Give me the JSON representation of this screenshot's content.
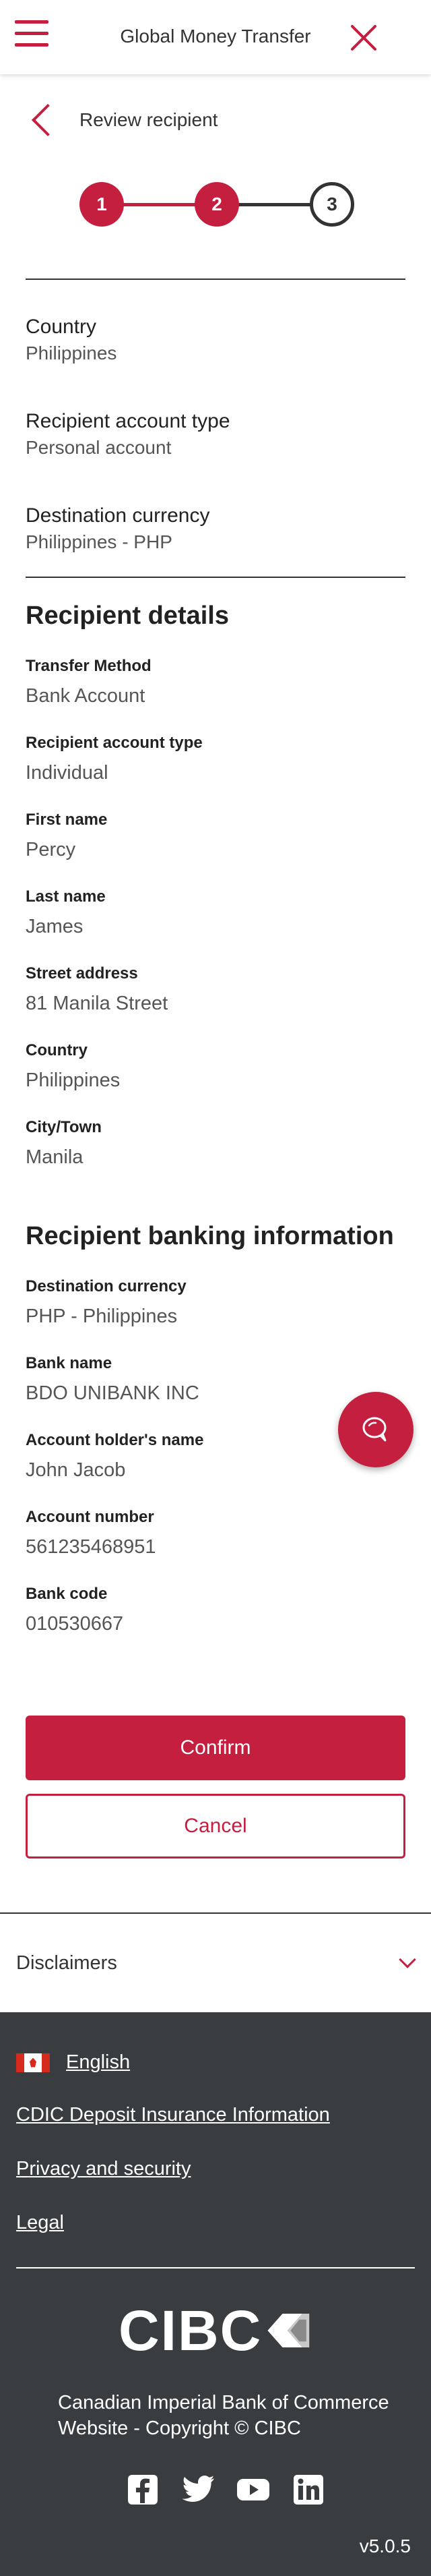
{
  "header": {
    "title": "Global Money Transfer"
  },
  "back": {
    "label": "Review recipient"
  },
  "stepper": {
    "steps": [
      "1",
      "2",
      "3"
    ],
    "current": 3
  },
  "summary": [
    {
      "label": "Country",
      "value": "Philippines"
    },
    {
      "label": "Recipient account type",
      "value": "Personal account"
    },
    {
      "label": "Destination currency",
      "value": "Philippines - PHP"
    }
  ],
  "recipient_details": {
    "title": "Recipient details",
    "fields": [
      {
        "label": "Transfer Method",
        "value": "Bank Account"
      },
      {
        "label": "Recipient account type",
        "value": "Individual"
      },
      {
        "label": "First name",
        "value": "Percy"
      },
      {
        "label": "Last name",
        "value": "James"
      },
      {
        "label": "Street address",
        "value": "81 Manila Street"
      },
      {
        "label": "Country",
        "value": "Philippines"
      },
      {
        "label": "City/Town",
        "value": "Manila"
      }
    ]
  },
  "banking": {
    "title": "Recipient banking information",
    "fields": [
      {
        "label": "Destination currency",
        "value": "PHP - Philippines"
      },
      {
        "label": "Bank name",
        "value": "BDO UNIBANK INC"
      },
      {
        "label": "Account holder's name",
        "value": "John Jacob"
      },
      {
        "label": "Account number",
        "value": "561235468951"
      },
      {
        "label": "Bank code",
        "value": "010530667"
      }
    ]
  },
  "actions": {
    "confirm": "Confirm",
    "cancel": "Cancel"
  },
  "disclaimers": {
    "label": "Disclaimers"
  },
  "footer": {
    "language": "English",
    "links": [
      "CDIC Deposit Insurance Information",
      "Privacy and security",
      "Legal"
    ],
    "logo_text": "CIBC",
    "copyright": "Canadian Imperial Bank of Commerce Website - Copyright © CIBC",
    "socials": [
      "facebook-icon",
      "twitter-icon",
      "youtube-icon",
      "linkedin-icon"
    ],
    "version": "v5.0.5"
  },
  "colors": {
    "brand": "#c41f3e",
    "footer_bg": "#3a3d40",
    "text": "#333333"
  }
}
